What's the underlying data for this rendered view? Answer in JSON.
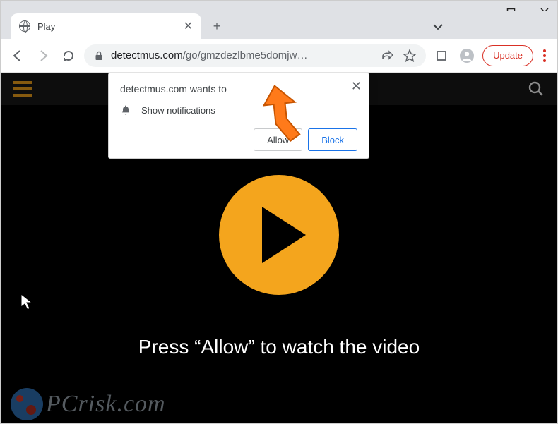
{
  "window": {
    "minimize": "—",
    "maximize": "▢",
    "close": "✕"
  },
  "tab": {
    "title": "Play",
    "close": "✕",
    "new": "+"
  },
  "tabstrip": {
    "chevron": "⌄"
  },
  "address": {
    "host": "detectmus.com",
    "path": "/go/gmzdezlbme5domjw…",
    "share_icon": "share",
    "star_icon": "star",
    "ext_icon": "ext",
    "profile_icon": "profile",
    "update_label": "Update"
  },
  "notification": {
    "title": "detectmus.com wants to",
    "permission_label": "Show notifications",
    "allow_label": "Allow",
    "block_label": "Block",
    "close": "✕"
  },
  "page": {
    "prompt_text": "Press “Allow” to watch the video"
  },
  "watermark": {
    "text": "PCrisk.com"
  }
}
